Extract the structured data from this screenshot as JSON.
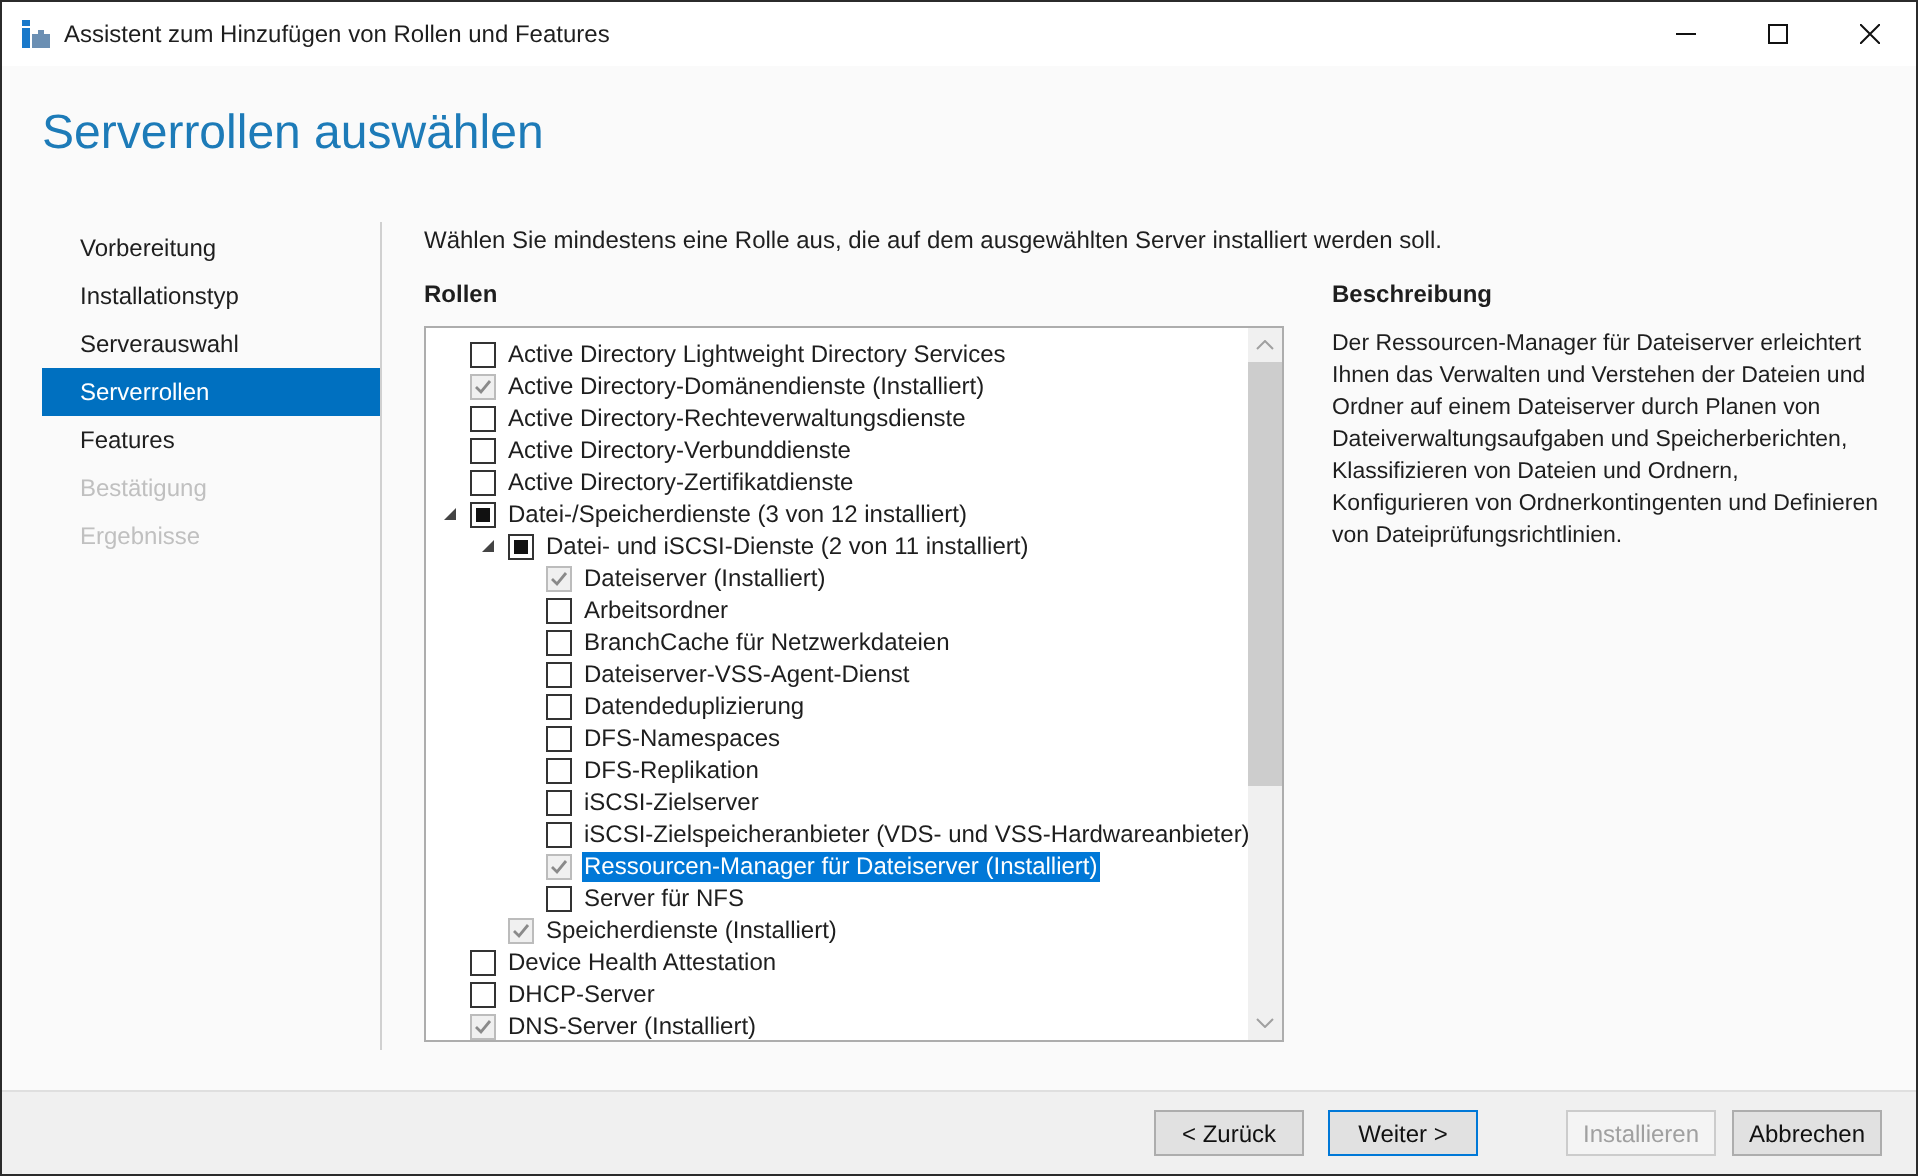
{
  "window": {
    "title": "Assistent zum Hinzufügen von Rollen und Features"
  },
  "page_title": "Serverrollen auswählen",
  "steps": [
    {
      "label": "Vorbereitung",
      "selected": false,
      "disabled": false
    },
    {
      "label": "Installationstyp",
      "selected": false,
      "disabled": false
    },
    {
      "label": "Serverauswahl",
      "selected": false,
      "disabled": false
    },
    {
      "label": "Serverrollen",
      "selected": true,
      "disabled": false
    },
    {
      "label": "Features",
      "selected": false,
      "disabled": false
    },
    {
      "label": "Bestätigung",
      "selected": false,
      "disabled": true
    },
    {
      "label": "Ergebnisse",
      "selected": false,
      "disabled": true
    }
  ],
  "instruction": "Wählen Sie mindestens eine Rolle aus, die auf dem ausgewählten Server installiert werden soll.",
  "roles": {
    "heading": "Rollen",
    "items": [
      {
        "label": "Active Directory Lightweight Directory Services",
        "checked": false,
        "indeterminate": false,
        "disabled": false,
        "selected": false
      },
      {
        "label": "Active Directory-Domänendienste (Installiert)",
        "checked": true,
        "indeterminate": false,
        "disabled": true,
        "selected": false
      },
      {
        "label": "Active Directory-Rechteverwaltungsdienste",
        "checked": false,
        "indeterminate": false,
        "disabled": false,
        "selected": false
      },
      {
        "label": "Active Directory-Verbunddienste",
        "checked": false,
        "indeterminate": false,
        "disabled": false,
        "selected": false
      },
      {
        "label": "Active Directory-Zertifikatdienste",
        "checked": false,
        "indeterminate": false,
        "disabled": false,
        "selected": false
      },
      {
        "label": "Datei-/Speicherdienste (3 von 12 installiert)",
        "checked": false,
        "indeterminate": true,
        "disabled": false,
        "selected": false,
        "expanded": true,
        "children": [
          {
            "label": "Datei- und iSCSI-Dienste (2 von 11 installiert)",
            "checked": false,
            "indeterminate": true,
            "disabled": false,
            "selected": false,
            "expanded": true,
            "children": [
              {
                "label": "Dateiserver (Installiert)",
                "checked": true,
                "indeterminate": false,
                "disabled": true,
                "selected": false
              },
              {
                "label": "Arbeitsordner",
                "checked": false,
                "indeterminate": false,
                "disabled": false,
                "selected": false
              },
              {
                "label": "BranchCache für Netzwerkdateien",
                "checked": false,
                "indeterminate": false,
                "disabled": false,
                "selected": false
              },
              {
                "label": "Dateiserver-VSS-Agent-Dienst",
                "checked": false,
                "indeterminate": false,
                "disabled": false,
                "selected": false
              },
              {
                "label": "Datendeduplizierung",
                "checked": false,
                "indeterminate": false,
                "disabled": false,
                "selected": false
              },
              {
                "label": "DFS-Namespaces",
                "checked": false,
                "indeterminate": false,
                "disabled": false,
                "selected": false
              },
              {
                "label": "DFS-Replikation",
                "checked": false,
                "indeterminate": false,
                "disabled": false,
                "selected": false
              },
              {
                "label": "iSCSI-Zielserver",
                "checked": false,
                "indeterminate": false,
                "disabled": false,
                "selected": false
              },
              {
                "label": "iSCSI-Zielspeicheranbieter (VDS- und VSS-Hardwareanbieter)",
                "checked": false,
                "indeterminate": false,
                "disabled": false,
                "selected": false
              },
              {
                "label": "Ressourcen-Manager für Dateiserver (Installiert)",
                "checked": true,
                "indeterminate": false,
                "disabled": true,
                "selected": true
              },
              {
                "label": "Server für NFS",
                "checked": false,
                "indeterminate": false,
                "disabled": false,
                "selected": false
              }
            ]
          },
          {
            "label": "Speicherdienste (Installiert)",
            "checked": true,
            "indeterminate": false,
            "disabled": true,
            "selected": false
          }
        ]
      },
      {
        "label": "Device Health Attestation",
        "checked": false,
        "indeterminate": false,
        "disabled": false,
        "selected": false
      },
      {
        "label": "DHCP-Server",
        "checked": false,
        "indeterminate": false,
        "disabled": false,
        "selected": false
      },
      {
        "label": "DNS-Server (Installiert)",
        "checked": true,
        "indeterminate": false,
        "disabled": true,
        "selected": false
      }
    ]
  },
  "description": {
    "heading": "Beschreibung",
    "text": "Der Ressourcen-Manager für Dateiserver erleichtert Ihnen das Verwalten und Verstehen der Dateien und Ordner auf einem Dateiserver durch Planen von Dateiverwaltungsaufgaben und Speicherberichten, Klassifizieren von Dateien und Ordnern, Konfigurieren von Ordnerkontingenten und Definieren von Dateiprüfungsrichtlinien."
  },
  "buttons": [
    {
      "label": "< Zurück",
      "default": false,
      "disabled": false
    },
    {
      "label": "Weiter >",
      "default": true,
      "disabled": false
    },
    {
      "label": "Installieren",
      "default": false,
      "disabled": true
    },
    {
      "label": "Abbrechen",
      "default": false,
      "disabled": false
    }
  ]
}
